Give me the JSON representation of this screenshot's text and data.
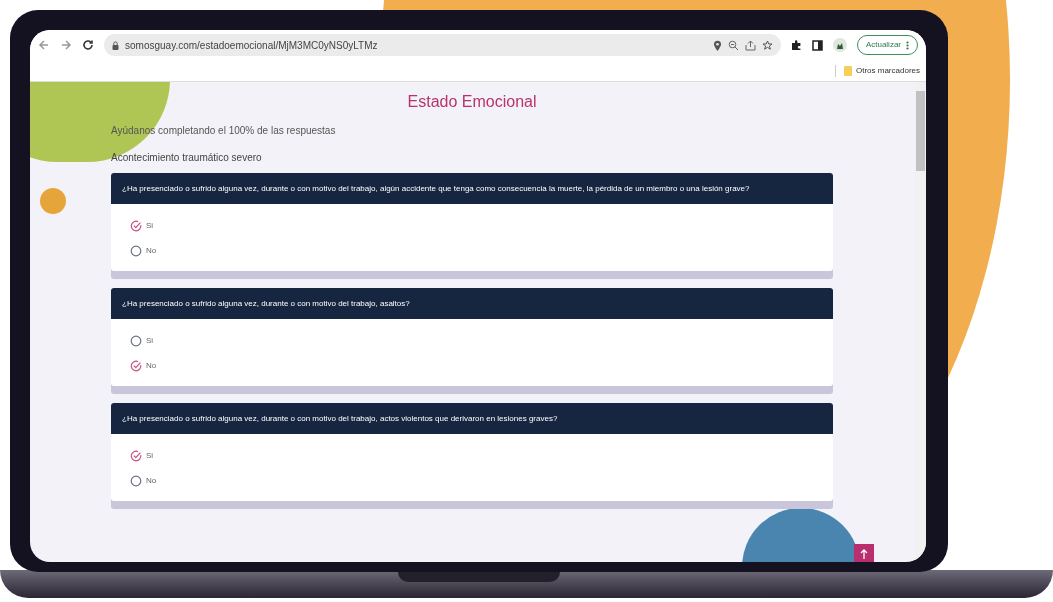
{
  "browser": {
    "url": "somosguay.com/estadoemocional/MjM3MC0yNS0yLTMz",
    "update_button": "Actualizar",
    "bookmarks": [
      "Otros marcadores"
    ]
  },
  "page": {
    "title": "Estado Emocional",
    "subtitle": "Ayúdanos completando el 100% de las respuestas",
    "section": "Acontecimiento traumático severo",
    "questions": [
      {
        "text": "¿Ha presenciado o sufrido alguna vez, durante o con motivo del trabajo, algún accidente que tenga como consecuencia la muerte, la pérdida de un miembro o una lesión grave?",
        "options": [
          {
            "label": "Si",
            "selected": true
          },
          {
            "label": "No",
            "selected": false
          }
        ]
      },
      {
        "text": "¿Ha presenciado o sufrido alguna vez, durante o con motivo del trabajo, asaltos?",
        "options": [
          {
            "label": "Si",
            "selected": false
          },
          {
            "label": "No",
            "selected": true
          }
        ]
      },
      {
        "text": "¿Ha presenciado o sufrido alguna vez, durante o con motivo del trabajo, actos violentos que derivaron en lesiones graves?",
        "options": [
          {
            "label": "Si",
            "selected": true
          },
          {
            "label": "No",
            "selected": false
          }
        ]
      }
    ]
  }
}
